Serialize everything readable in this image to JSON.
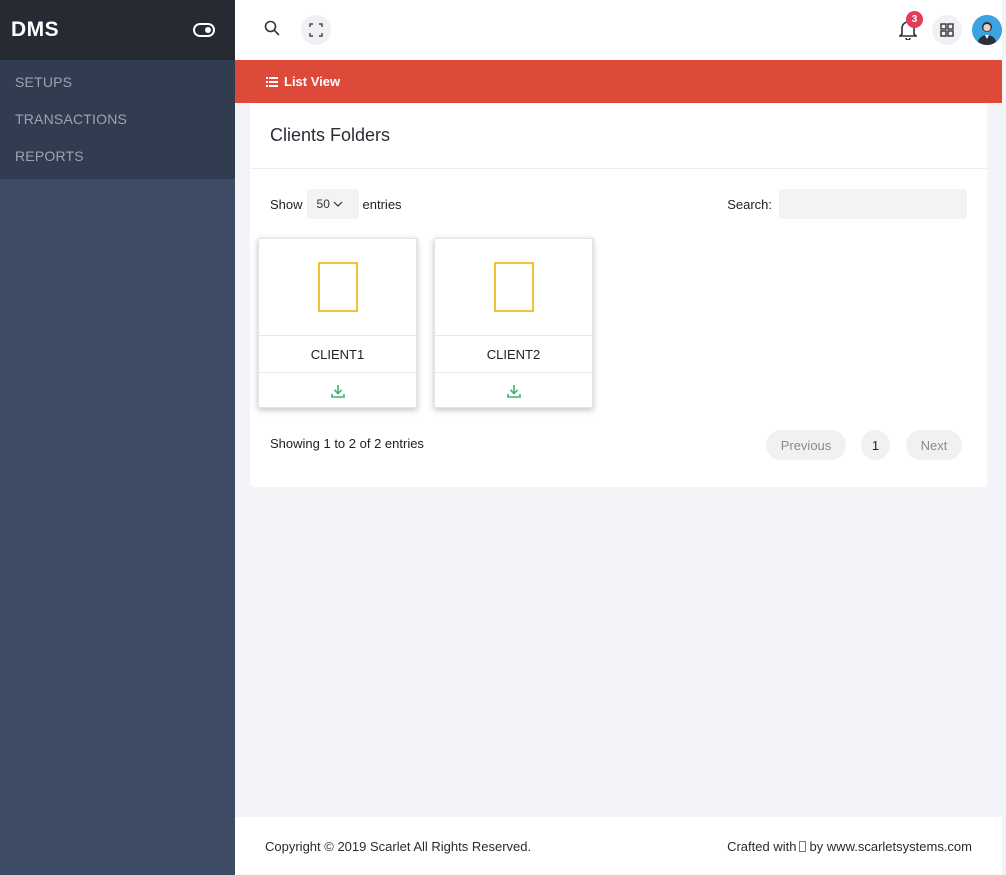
{
  "sidebar": {
    "brand": "DMS",
    "items": [
      {
        "label": "SETUPS"
      },
      {
        "label": "TRANSACTIONS"
      },
      {
        "label": "REPORTS"
      }
    ]
  },
  "topbar": {
    "notification_count": "3",
    "icons": [
      "search-icon",
      "fullscreen-icon",
      "bell-icon",
      "apps-grid-icon",
      "user-avatar"
    ]
  },
  "listbar": {
    "label": "List View",
    "color": "#dd4a3a"
  },
  "card": {
    "title": "Clients Folders",
    "show_label": "Show",
    "entries_value": "50",
    "entries_label": "entries",
    "search_label": "Search:",
    "search_value": "",
    "folders": [
      {
        "name": "CLIENT1"
      },
      {
        "name": "CLIENT2"
      }
    ],
    "info": "Showing 1 to 2 of 2 entries",
    "pagination": {
      "previous": "Previous",
      "current": "1",
      "next": "Next"
    }
  },
  "footer": {
    "copyright": "Copyright © 2019 Scarlet All Rights Reserved.",
    "crafted_prefix": "Crafted with",
    "crafted_suffix": "by www.scarletsystems.com"
  }
}
